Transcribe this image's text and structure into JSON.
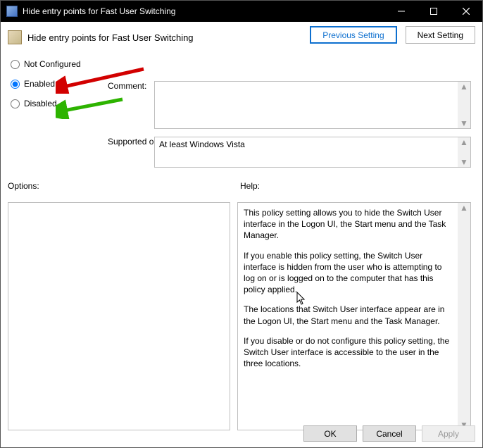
{
  "window": {
    "title": "Hide entry points for Fast User Switching",
    "header_label": "Hide entry points for Fast User Switching"
  },
  "nav": {
    "previous": "Previous Setting",
    "next": "Next Setting"
  },
  "radios": {
    "not_configured": "Not Configured",
    "enabled": "Enabled",
    "disabled": "Disabled",
    "selected": "enabled"
  },
  "labels": {
    "comment": "Comment:",
    "supported_on": "Supported on:",
    "options": "Options:",
    "help": "Help:"
  },
  "comment": "",
  "supported_on": "At least Windows Vista",
  "help": {
    "p1": "This policy setting allows you to hide the Switch User interface in the Logon UI, the Start menu and the Task Manager.",
    "p2": "If you enable this policy setting, the Switch User interface is hidden from the user who is attempting to log on or is logged on to the computer that has this policy applied.",
    "p3": "The locations that Switch User interface appear are in the Logon UI, the Start menu and the Task Manager.",
    "p4": "If you disable or do not configure this policy setting, the Switch User interface is accessible to the user in the three locations."
  },
  "footer": {
    "ok": "OK",
    "cancel": "Cancel",
    "apply": "Apply"
  }
}
